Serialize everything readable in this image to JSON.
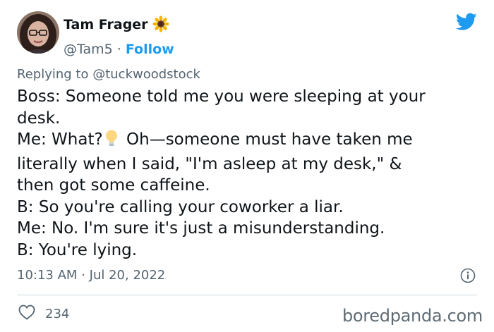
{
  "author": {
    "display_name": "Tam Frager",
    "handle": "@Tam5",
    "separator": "·",
    "follow_label": "Follow",
    "name_emoji_icon": "sunflower-icon"
  },
  "reply": {
    "prefix": "Replying to",
    "handle": "@tuckwoodstock"
  },
  "tweet": {
    "lines": [
      "Boss: Someone told me you were sleeping at your",
      "desk.",
      "Me: What?",
      "Oh—someone must have taken me",
      "literally when I said, \"I'm asleep at my desk,\" &",
      "then got some caffeine.",
      "B: So you're calling your coworker a liar.",
      "Me: No. I'm sure it's just a misunderstanding.",
      "B: You're lying."
    ],
    "inline_emoji_icon": "light-bulb-icon"
  },
  "meta": {
    "time": "10:13 AM",
    "separator": "·",
    "date": "Jul 20, 2022"
  },
  "actions": {
    "like_count": "234"
  },
  "watermark": "boredpanda.com",
  "colors": {
    "text": "#0f1419",
    "secondary": "#536471",
    "accent": "#1d9bf0",
    "divider": "#cfd9de"
  }
}
